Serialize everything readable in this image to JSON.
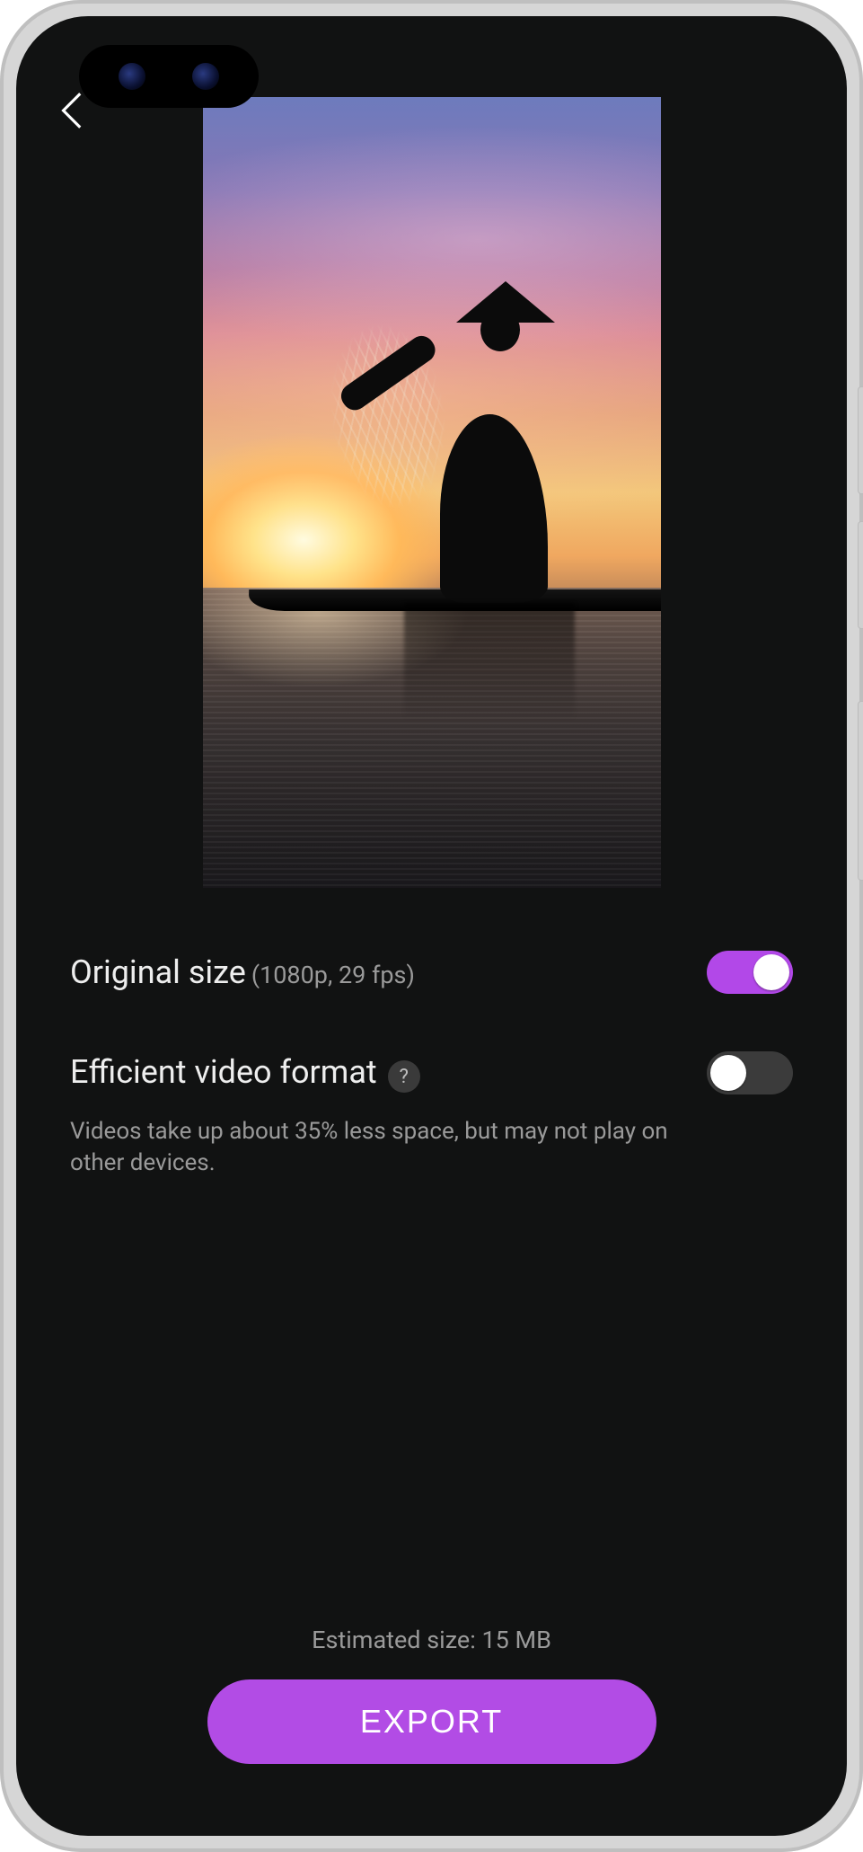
{
  "settings": {
    "original_size": {
      "label": "Original size",
      "detail": "(1080p, 29 fps)",
      "enabled": true
    },
    "efficient_format": {
      "label": "Efficient video format",
      "help_symbol": "?",
      "enabled": false,
      "description": "Videos take up about 35% less space, but may not play on other devices."
    }
  },
  "footer": {
    "estimated_size": "Estimated size: 15 MB",
    "export_label": "EXPORT"
  },
  "colors": {
    "accent": "#b24ce5",
    "toggle_on": "#b248e8"
  }
}
